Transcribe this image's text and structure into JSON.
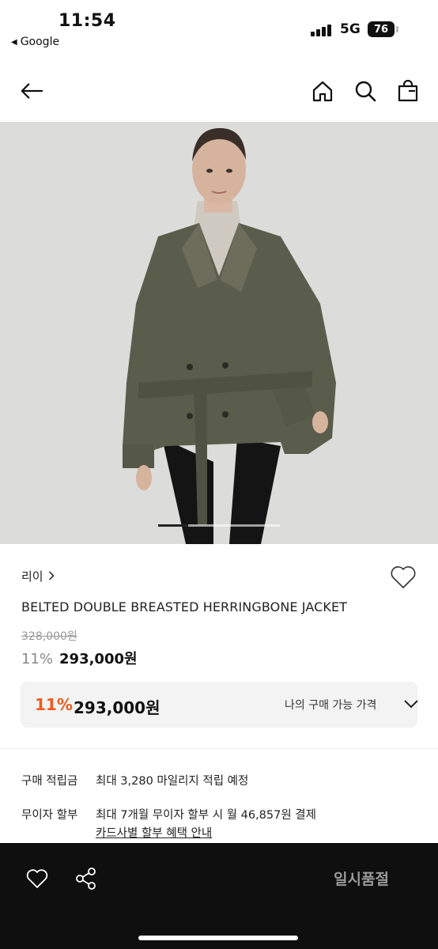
{
  "status_bar": {
    "time": "11:54",
    "back_app": "Google",
    "network": "5G",
    "battery": "76"
  },
  "nav": {
    "icons": [
      "back-arrow-icon",
      "home-icon",
      "search-icon",
      "shopping-bag-icon"
    ]
  },
  "gallery": {
    "current_index": 1,
    "image_description_icon": "product-photo"
  },
  "product": {
    "brand": "리이",
    "brand_chevron": "›",
    "name": "BELTED DOUBLE BREASTED HERRINGBONE JACKET",
    "original_price": "328,000원",
    "discount_rate": "11%",
    "sale_price": "293,000원"
  },
  "my_price": {
    "discount_rate": "11%",
    "price": "293,000원",
    "label": "나의 구매 가능 가격"
  },
  "benefits": {
    "points_key": "구매 적립금",
    "points_value": "최대 3,280 마일리지 적립 예정",
    "installment_key": "무이자 할부",
    "installment_value": "최대 7개월 무이자 할부 시 월 46,857원 결제",
    "card_link": "카드사별 할부 혜택 안내"
  },
  "bottom_bar": {
    "soldout_label": "일시품절"
  },
  "colors": {
    "accent_discount": "#f05a1e",
    "bottom_bar_bg": "#0f0f0f"
  }
}
